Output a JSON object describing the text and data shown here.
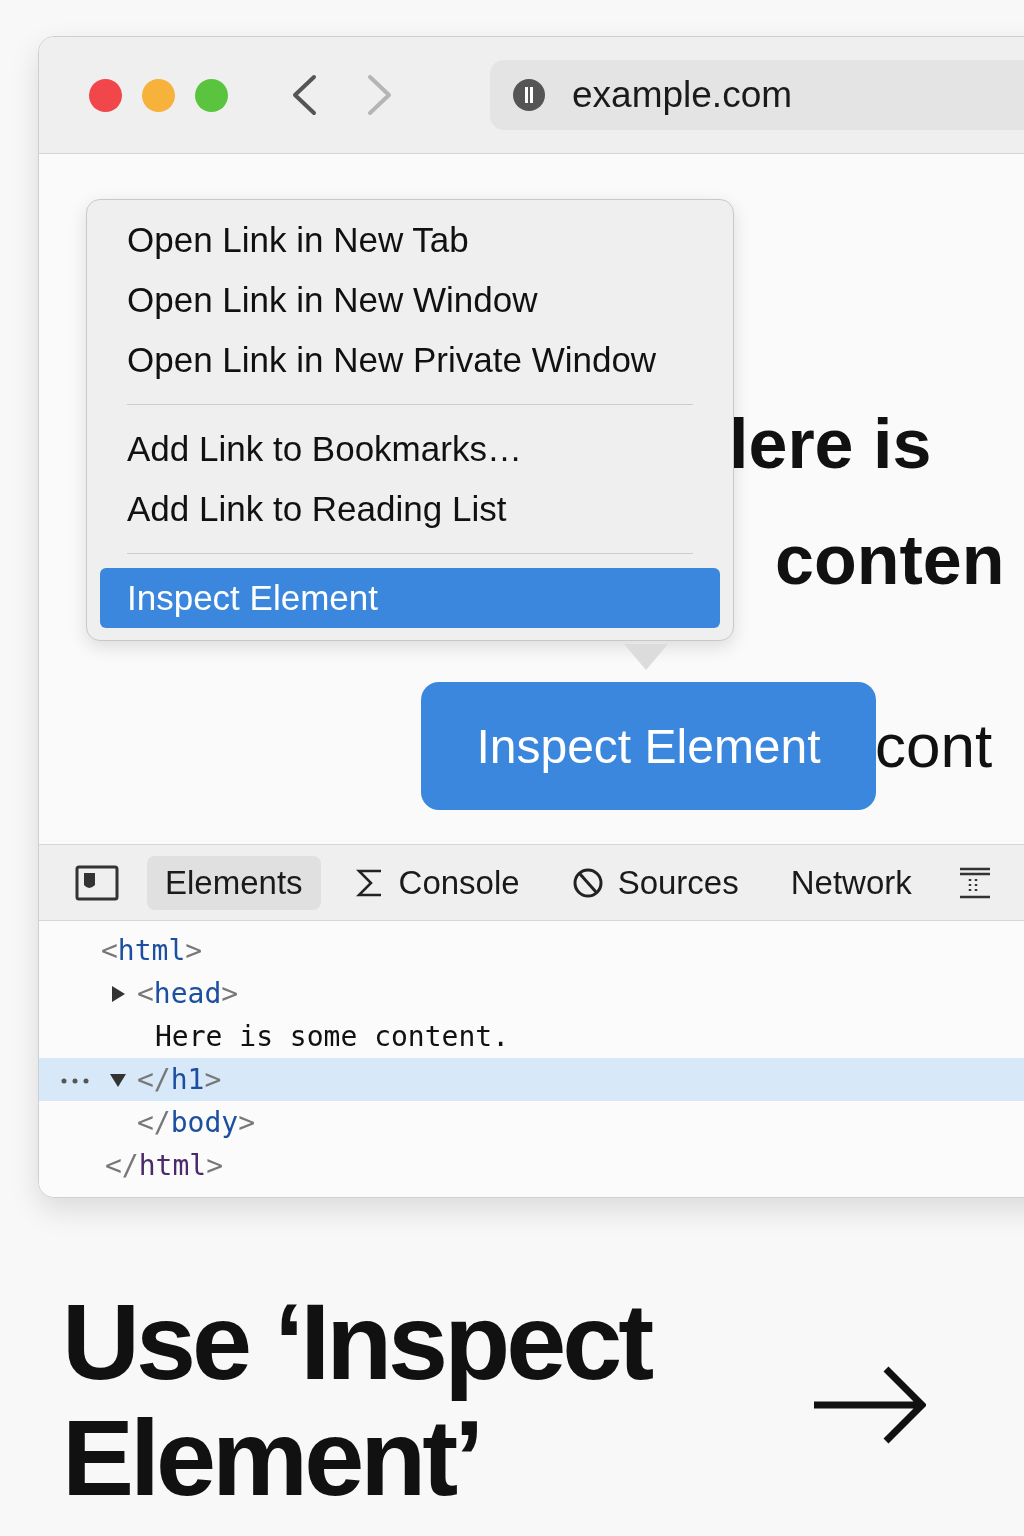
{
  "browser": {
    "traffic_lights": [
      {
        "color": "#f2474a"
      },
      {
        "color": "#f7b23b"
      },
      {
        "color": "#5ac43f"
      }
    ],
    "nav_buttons": [
      {
        "kind": "back",
        "disabled": false
      },
      {
        "kind": "forward",
        "disabled": true
      }
    ],
    "address": "example.com"
  },
  "page_text": [
    "lere is",
    "conten",
    "cont"
  ],
  "context_menu": {
    "sections": [
      {
        "items": [
          {
            "label": "Open Link in New Tab",
            "selected": false
          },
          {
            "label": "Open Link in New Window",
            "selected": false
          },
          {
            "label": "Open Link in New Private Window",
            "selected": false
          }
        ]
      },
      {
        "items": [
          {
            "label": "Add Link to Bookmarks…",
            "selected": false
          },
          {
            "label": "Add Link to Reading List",
            "selected": false
          }
        ]
      },
      {
        "items": [
          {
            "label": "Inspect Element",
            "selected": true
          }
        ]
      }
    ]
  },
  "callout": {
    "label": "Inspect Element"
  },
  "devtools": {
    "tabs": [
      {
        "kind": "dock",
        "selected": false
      },
      {
        "kind": "elements",
        "label": "Elements",
        "selected": true
      },
      {
        "kind": "console",
        "label": "Console",
        "selected": false
      },
      {
        "kind": "sources",
        "label": "Sources",
        "selected": false
      },
      {
        "kind": "network",
        "label": "Network",
        "selected": false
      },
      {
        "kind": "more",
        "selected": false
      }
    ],
    "dom": [
      {
        "kind": "element",
        "markup": "<html>",
        "children": [
          {
            "kind": "element",
            "markup": "<head>",
            "expanded": false,
            "selected": false
          },
          {
            "kind": "text",
            "text": "Here is some content."
          },
          {
            "kind": "element",
            "markup": "</h1>",
            "expanded": true,
            "selected": true
          },
          {
            "kind": "element",
            "markup": "</body>",
            "selected": false
          }
        ],
        "selected": false
      },
      {
        "kind": "element",
        "markup": "</html>",
        "selected": false
      }
    ]
  },
  "caption": {
    "title": "Use ‘Inspect Element’"
  }
}
